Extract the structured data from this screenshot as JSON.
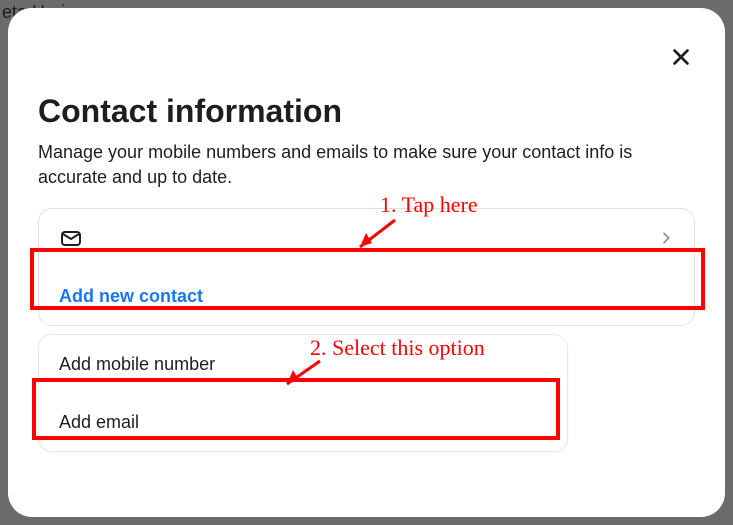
{
  "background_text": "eta Horizon",
  "modal": {
    "title": "Contact information",
    "subtitle": "Manage your mobile numbers and emails to make sure your contact info is accurate and up to date.",
    "add_contact_label": "Add new contact",
    "dropdown": {
      "option_mobile": "Add mobile number",
      "option_email": "Add email"
    }
  },
  "annotations": {
    "step1": "1. Tap here",
    "step2": "2. Select this option"
  }
}
